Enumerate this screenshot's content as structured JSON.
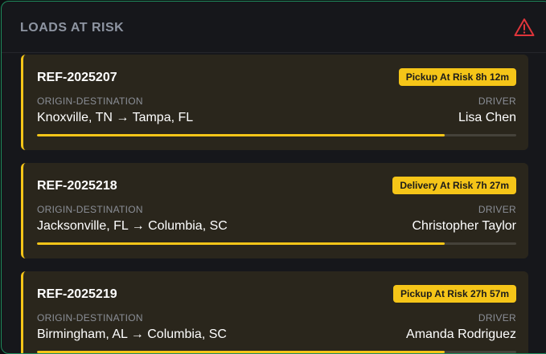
{
  "header": {
    "title": "LOADS AT RISK",
    "icon": "alert-triangle-icon",
    "icon_color": "#e0353b"
  },
  "colors": {
    "accent": "#f5c518",
    "panel_border": "#1f8a5c",
    "card_bg": "#2a261c"
  },
  "labels": {
    "origin_destination": "ORIGIN-DESTINATION",
    "driver": "DRIVER"
  },
  "loads": [
    {
      "ref": "REF-2025207",
      "badge": "Pickup At Risk 8h 12m",
      "route": "Knoxville, TN → Tampa, FL",
      "driver": "Lisa Chen",
      "progress": 0.85
    },
    {
      "ref": "REF-2025218",
      "badge": "Delivery At Risk 7h 27m",
      "route": "Jacksonville, FL → Columbia, SC",
      "driver": "Christopher Taylor",
      "progress": 0.85
    },
    {
      "ref": "REF-2025219",
      "badge": "Pickup At Risk 27h 57m",
      "route": "Birmingham, AL → Columbia, SC",
      "driver": "Amanda Rodriguez",
      "progress": 0.85
    }
  ]
}
